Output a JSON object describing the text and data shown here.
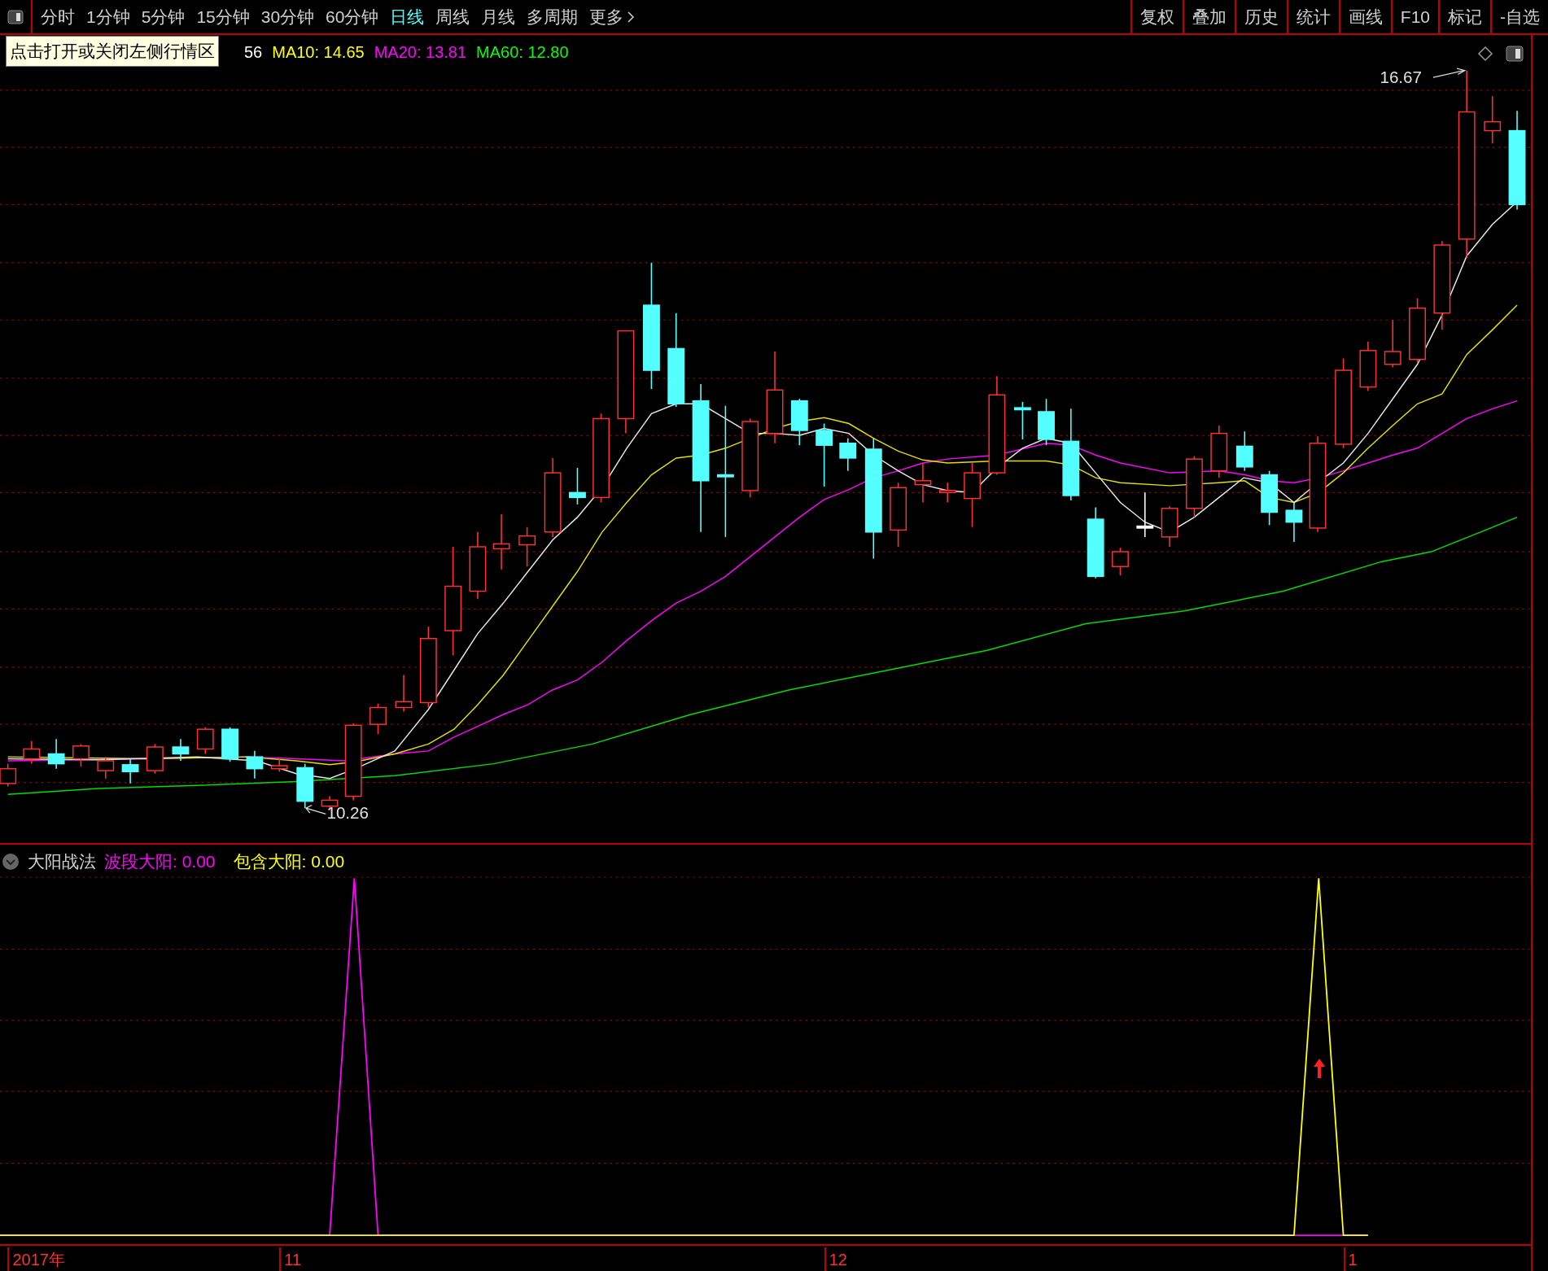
{
  "toolbar": {
    "periods": [
      {
        "label": "分时",
        "selected": false
      },
      {
        "label": "1分钟",
        "selected": false
      },
      {
        "label": "5分钟",
        "selected": false
      },
      {
        "label": "15分钟",
        "selected": false
      },
      {
        "label": "30分钟",
        "selected": false
      },
      {
        "label": "60分钟",
        "selected": false
      },
      {
        "label": "日线",
        "selected": true
      },
      {
        "label": "周线",
        "selected": false
      },
      {
        "label": "月线",
        "selected": false
      },
      {
        "label": "多周期",
        "selected": false
      }
    ],
    "more": "更多",
    "tools": [
      "复权",
      "叠加",
      "历史",
      "统计",
      "画线",
      "F10",
      "标记",
      "-自选"
    ]
  },
  "tooltip": "点击打开或关闭左侧行情区",
  "legend": [
    {
      "text": "56",
      "color": "#ffffff"
    },
    {
      "text": "MA10: 14.65",
      "color": "#ffff00"
    },
    {
      "text": "MA20: 13.81",
      "color": "#ff00ff"
    },
    {
      "text": "MA60: 12.80",
      "color": "#00ff00"
    }
  ],
  "price_labels": {
    "high": "16.67",
    "low": "10.26"
  },
  "indicator": {
    "title": "大阳战法",
    "lines": [
      {
        "text": "波段大阳: 0.00",
        "color": "#ff00ff"
      },
      {
        "text": "包含大阳: 0.00",
        "color": "#ffff00"
      }
    ]
  },
  "x_axis": [
    "2017年",
    "11",
    "12",
    "1"
  ]
}
